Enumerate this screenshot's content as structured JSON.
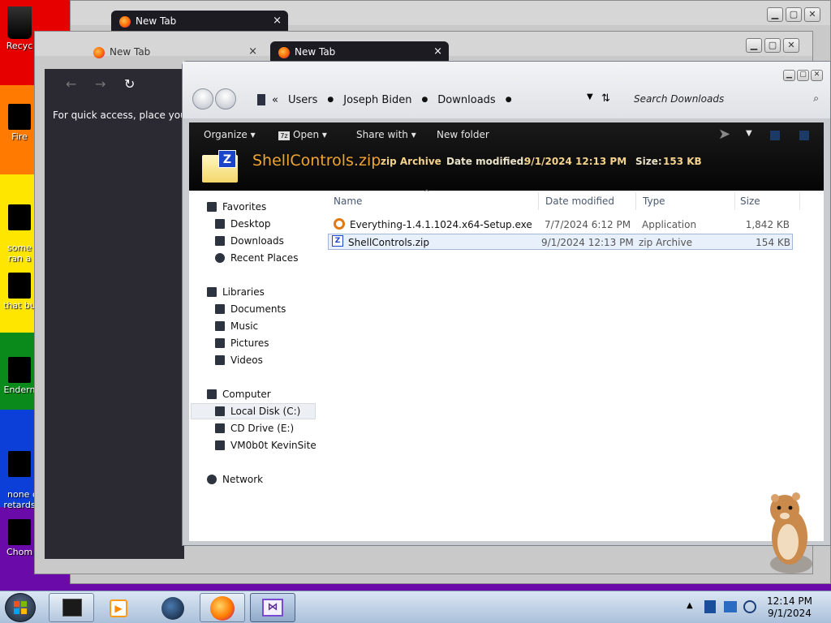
{
  "desktop": {
    "icons": [
      {
        "label": "Recyc"
      },
      {
        "label": "Fire"
      },
      {
        "label": "some r\nran a"
      },
      {
        "label": "that bu"
      },
      {
        "label": "Endern"
      },
      {
        "label": "none o\nretards"
      },
      {
        "label": "Chom"
      }
    ]
  },
  "browser_back": {
    "tab_title": "New Tab",
    "close_glyph": "×"
  },
  "browser_mid": {
    "tab1_title": "New Tab",
    "tab2_title": "New Tab",
    "close_glyph": "×",
    "nav_back": "←",
    "nav_forward": "→",
    "nav_reload": "↻",
    "quick_access": "For quick access, place your"
  },
  "explorer": {
    "breadcrumb": [
      "Users",
      "Joseph Biden",
      "Downloads"
    ],
    "search_placeholder": "Search Downloads",
    "commands": {
      "organize": "Organize",
      "open": "Open",
      "share_with": "Share with",
      "new_folder": "New folder"
    },
    "details": {
      "file_name": "ShellControls.zip",
      "file_type": "zip Archive",
      "date_label": "Date modified:",
      "date_value": "9/1/2024 12:13 PM",
      "size_label": "Size:",
      "size_value": "153 KB"
    },
    "nav": {
      "favorites": "Favorites",
      "desktop": "Desktop",
      "downloads": "Downloads",
      "recent": "Recent Places",
      "libraries": "Libraries",
      "documents": "Documents",
      "music": "Music",
      "pictures": "Pictures",
      "videos": "Videos",
      "computer": "Computer",
      "local_disk": "Local Disk (C:)",
      "cd_drive": "CD Drive (E:)",
      "kevinsite": "VM0b0t KevinSite",
      "network": "Network"
    },
    "columns": {
      "name": "Name",
      "date": "Date modified",
      "type": "Type",
      "size": "Size"
    },
    "files": [
      {
        "name": "Everything-1.4.1.1024.x64-Setup.exe",
        "date": "7/7/2024 6:12 PM",
        "type": "Application",
        "size": "1,842 KB"
      },
      {
        "name": "ShellControls.zip",
        "date": "9/1/2024 12:13 PM",
        "type": "zip Archive",
        "size": "154 KB"
      }
    ]
  },
  "taskbar": {
    "time": "12:14 PM",
    "date": "9/1/2024"
  }
}
